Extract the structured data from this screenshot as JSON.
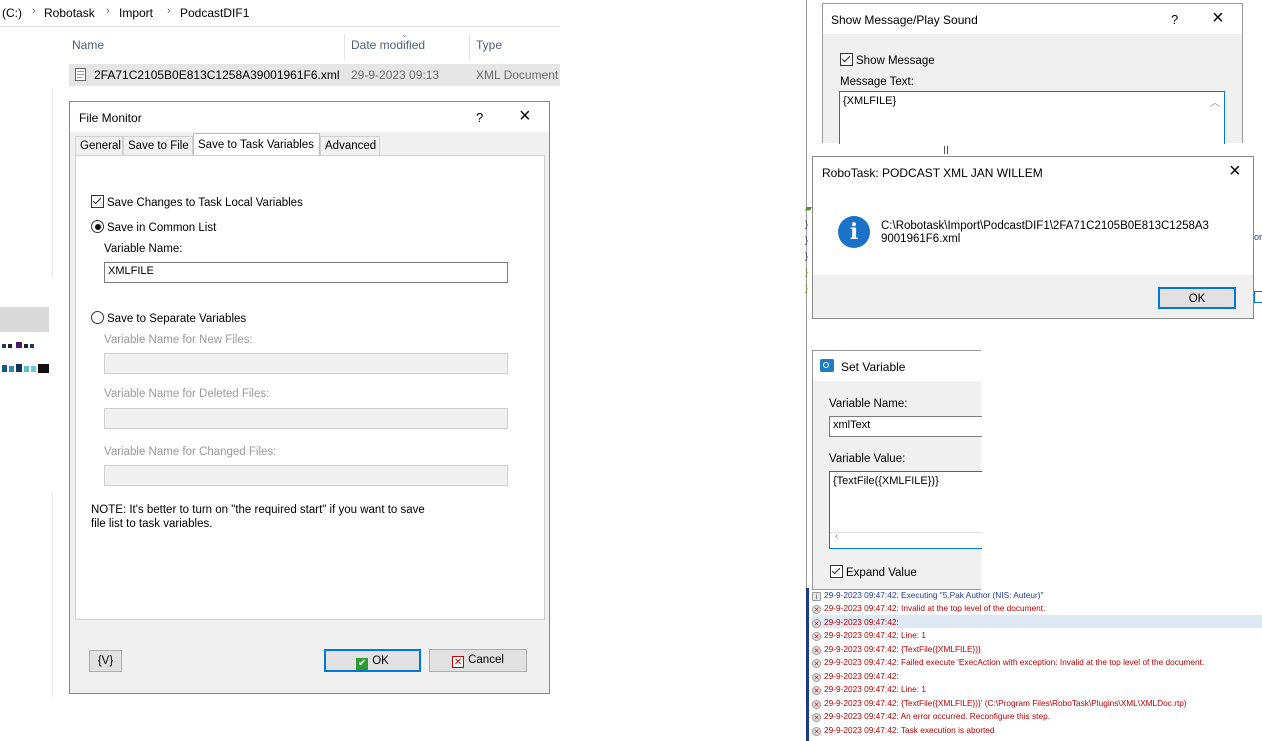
{
  "explorer": {
    "breadcrumb": [
      "(C:)",
      "Robotask",
      "Import",
      "PodcastDIF1"
    ],
    "columns": [
      "Name",
      "Date modified",
      "Type"
    ],
    "file": {
      "name": "2FA71C2105B0E813C1258A39001961F6.xml",
      "date": "29-9-2023 09:13",
      "type": "XML Document"
    }
  },
  "file_monitor": {
    "title": "File Monitor",
    "help": "?",
    "close": "×",
    "tabs": [
      "General",
      "Save to File",
      "Save to Task Variables",
      "Advanced"
    ],
    "save_changes_label": "Save Changes to Task Local Variables",
    "save_common_label": "Save in Common List",
    "variable_name_label": "Variable Name:",
    "variable_name_value": "XMLFILE",
    "save_separate_label": "Save to Separate Variables",
    "new_files_label": "Variable Name for New Files:",
    "deleted_files_label": "Variable Name for Deleted Files:",
    "changed_files_label": "Variable Name for Changed Files:",
    "note_line1": "NOTE: It's better to turn on \"the required start\" if you want to save",
    "note_line2": "file list to task variables.",
    "v_button": "{V}",
    "ok_button": "OK",
    "cancel_button": "Cancel"
  },
  "show_message": {
    "title": "Show Message/Play Sound",
    "help": "?",
    "close": "×",
    "show_message_label": "Show Message",
    "message_text_label": "Message Text:",
    "message_text_value": "{XMLFILE}"
  },
  "message_box": {
    "title": "RoboTask: PODCAST XML JAN WILLEM",
    "close": "×",
    "line1": "C:\\Robotask\\Import\\PodcastDIF1\\2FA71C2105B0E813C1258A3",
    "line2": "9001961F6.xml",
    "ok_button": "OK"
  },
  "set_variable": {
    "title": "Set Variable",
    "variable_name_label": "Variable Name:",
    "variable_name_value": "xmlText",
    "variable_value_label": "Variable Value:",
    "variable_value_value": "{TextFile({XMLFILE})}",
    "expand_value_label": "Expand Value"
  },
  "log": [
    {
      "text": "29-9-2023 09:47:42: Executing \"5.Pak Author (NIS: Auteur)\"",
      "kind": "info"
    },
    {
      "text": "29-9-2023 09:47:42: Invalid at the top level of the document.",
      "kind": "error"
    },
    {
      "text": "29-9-2023 09:47:42:",
      "kind": "error"
    },
    {
      "text": "29-9-2023 09:47:42: Line: 1",
      "kind": "error"
    },
    {
      "text": "29-9-2023 09:47:42: {TextFile({XMLFILE})}",
      "kind": "error"
    },
    {
      "text": "29-9-2023 09:47:42: Failed execute 'ExecAction with exception: Invalid at the top level of the document.",
      "kind": "error"
    },
    {
      "text": "29-9-2023 09:47:42:",
      "kind": "error"
    },
    {
      "text": "29-9-2023 09:47:42: Line: 1",
      "kind": "error"
    },
    {
      "text": "29-9-2023 09:47:42: {TextFile({XMLFILE})}' (C:\\Program Files\\RoboTask\\Plugins\\XML\\XMLDoc.rtp)",
      "kind": "error"
    },
    {
      "text": "29-9-2023 09:47:42: An error occurred. Reconfigure this step.",
      "kind": "error"
    },
    {
      "text": "29-9-2023 09:47:42: Task execution is aborted",
      "kind": "error"
    }
  ],
  "colors": {
    "accent_blue": "#0078d7",
    "info_icon": "#1a73c8",
    "error_red": "#c00000",
    "info_text": "#1f3aa6",
    "selected_row": "#dfe9f6"
  }
}
